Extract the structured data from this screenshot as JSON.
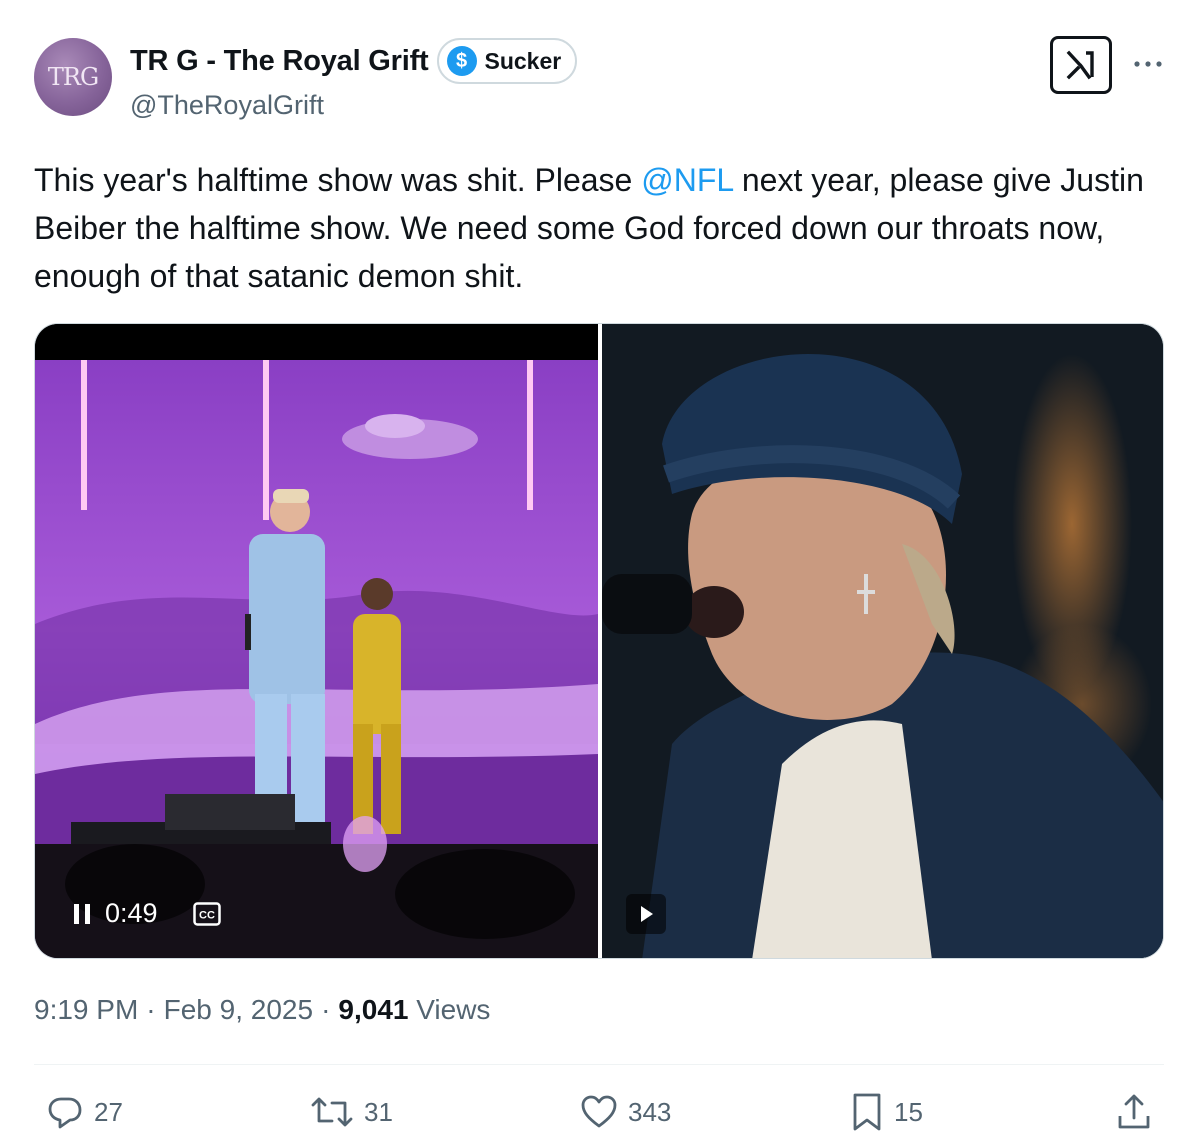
{
  "author": {
    "avatar_text": "TRG",
    "display_name": "TR G - The Royal Grift",
    "badge_icon": "$",
    "badge_label": "Sucker",
    "handle": "@TheRoyalGrift"
  },
  "icons": {
    "header": [
      "grok-icon",
      "more-icon"
    ],
    "actions": [
      "reply-icon",
      "retweet-icon",
      "like-icon",
      "bookmark-icon",
      "share-icon"
    ],
    "video": [
      "pause-icon",
      "closed-captions-icon",
      "play-icon"
    ]
  },
  "tweet": {
    "text_part1": "This year's halftime show was shit. Please ",
    "mention": "@NFL",
    "text_part2": " next year, please give Justin Beiber the halftime show.  We need some God forced down our throats now, enough of that satanic demon shit."
  },
  "media": {
    "video1_time": "0:49",
    "video1_cc_label": "CC"
  },
  "meta": {
    "time": "9:19 PM",
    "separator1": "·",
    "date": "Feb 9, 2025",
    "separator2": "·",
    "views_count": "9,041",
    "views_label": "Views"
  },
  "actions": {
    "replies": "27",
    "retweets": "31",
    "likes": "343",
    "bookmarks": "15"
  },
  "colors": {
    "accent": "#1d9bf0",
    "text_primary": "#0f1419",
    "text_secondary": "#536471",
    "border": "#cfd9de"
  }
}
